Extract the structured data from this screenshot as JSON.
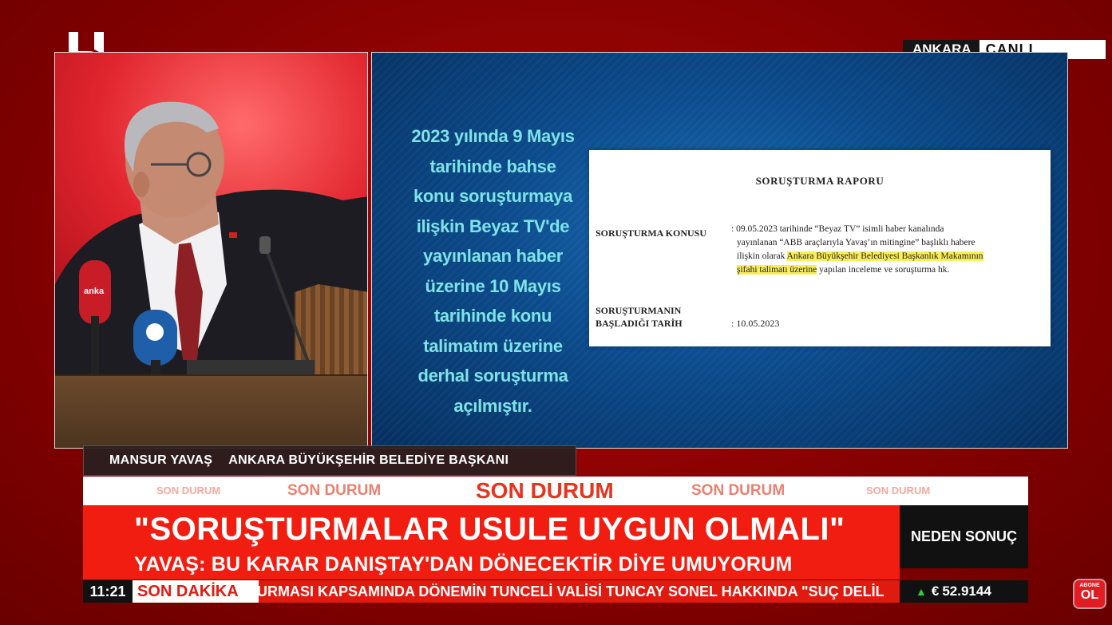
{
  "channel": {
    "logo_text": "halk"
  },
  "live": {
    "city": "ANKARA",
    "state": "CANLI"
  },
  "statement_lines": [
    "2023 yılında 9 Mayıs",
    "tarihinde bahse",
    "konu soruşturmaya",
    "ilişkin  Beyaz TV'de",
    "yayınlanan haber",
    "üzerine 10 Mayıs",
    "tarihinde konu",
    "talimatım üzerine",
    "derhal soruşturma",
    "açılmıştır."
  ],
  "document": {
    "title": "SORUŞTURMA RAPORU",
    "subject_label": "SORUŞTURMA KONUSU",
    "subject_line1": ": 09.05.2023 tarihinde “Beyaz TV” isimli haber kanalında",
    "subject_line2": "yayınlanan “ABB araçlarıyla Yavaş’ın mitingine” başlıklı habere",
    "subject_line3_plain": "ilişkin olarak ",
    "subject_line3_highlight": "Ankara Büyükşehir Belediyesi Başkanlık Makamının",
    "subject_line4_highlight": "şifahi talimatı üzerine",
    "subject_line4_plain": " yapılan inceleme ve soruşturma hk.",
    "start_label_line1": "SORUŞTURMANIN",
    "start_label_line2": "BAŞLADIĞI TARİH",
    "start_value": ": 10.05.2023"
  },
  "name_strap": {
    "person": "MANSUR YAVAŞ",
    "role": "ANKARA BÜYÜKŞEHİR BELEDİYE BAŞKANI"
  },
  "son_durum": "SON DURUM",
  "headline": "\"SORUŞTURMALAR USULE UYGUN OLMALI\"",
  "subheadline": "YAVAŞ: BU KARAR DANIŞTAY'DAN DÖNECEKTİR DİYE UMUYORUM",
  "side_box": "NEDEN SONUÇ",
  "clock": "11:21",
  "breaking_label": "SON DAKİKA",
  "ticker": "URMASI KAPSAMINDA DÖNEMİN TUNCELİ VALİSİ TUNCAY SONEL HAKKINDA \"SUÇ DELİL",
  "currency": {
    "symbol": "€",
    "value": "52.9144",
    "trend": "up"
  },
  "subscribe": {
    "line1": "ABONE",
    "line2": "OL"
  },
  "colors": {
    "brand_red": "#f01d10",
    "statement_cyan": "#7ee3e7",
    "highlight": "#f7ee5a"
  }
}
